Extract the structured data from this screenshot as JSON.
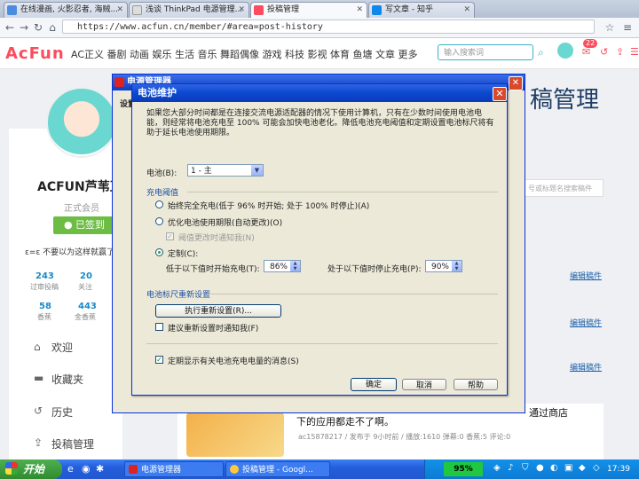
{
  "browser": {
    "tabs": [
      {
        "label": "在线漫画, 火影忍者, 海贼..."
      },
      {
        "label": "浅谈 ThinkPad 电源管理..."
      },
      {
        "label": "投稿管理"
      },
      {
        "label": "写文章 - 知乎"
      }
    ],
    "url": "https://www.acfun.cn/member/#area=post-history"
  },
  "site": {
    "logo": "AcFun",
    "nav": "AC正义 番剧 动画 娱乐 生活 音乐 舞蹈偶像 游戏 科技 影视 体育 鱼塘 文章 更多",
    "search_placeholder": "输入搜索词",
    "notif_count": "22"
  },
  "profile": {
    "username": "ACFUN芦苇直",
    "member": "正式会员",
    "sign_label": "已签到",
    "motto": "ε=ε 不要以为这样就赢了",
    "stats": [
      {
        "num": "243",
        "label": "过审投稿"
      },
      {
        "num": "20",
        "label": "关注"
      },
      {
        "num": "58",
        "label": "香蕉"
      },
      {
        "num": "443",
        "label": "金香蕉"
      }
    ],
    "menu": [
      "欢迎",
      "收藏夹",
      "历史",
      "投稿管理"
    ]
  },
  "right": {
    "title": "稿管理",
    "search_placeholder": "号或标题名搜索稿件",
    "edit_links": [
      "编辑稿件",
      "编辑稿件",
      "编辑稿件"
    ],
    "post_title": "下的应用都走不了啊。",
    "post_meta": "ac15878217 / 发布于 9小时前 / 播放:1610 弹幕:0 香蕉:5 评论:0",
    "store_text": "通过商店"
  },
  "outer_dialog": {
    "title": "电源管理器",
    "tab_hint": "设置"
  },
  "dialog": {
    "title": "电池维护",
    "description": "如果您大部分时间都是在连接交流电源适配器的情况下使用计算机，只有在少数时间使用电池电能，则经常将电池充电至 100% 可能会加快电池老化。降低电池充电阈值和定期设置电池标尺将有助于延长电池使用期限。",
    "battery_label": "电池(B):",
    "battery_value": "1 - 主",
    "threshold_group": "充电阈值",
    "option_full": "始终完全充电(低于 96% 时开始; 处于 100% 时停止)(A)",
    "option_optimize": "优化电池使用期限(自动更改)(O)",
    "option_notify": "阈值更改时通知我(N)",
    "option_custom": "定制(C):",
    "start_label": "低于以下值时开始充电(T):",
    "start_value": "86%",
    "stop_label": "处于以下值时停止充电(P):",
    "stop_value": "90%",
    "gauge_group": "电池标尺重新设置",
    "reset_button": "执行重新设置(R)...",
    "reset_notify": "建议重新设置时通知我(F)",
    "show_msg": "定期显示有关电池充电电量的消息(S)",
    "ok": "确定",
    "cancel": "取消",
    "help": "帮助"
  },
  "taskbar": {
    "start": "开始",
    "items": [
      "电源管理器",
      "投稿管理 - Googl..."
    ],
    "battery": "95%",
    "clock": "17:39"
  }
}
